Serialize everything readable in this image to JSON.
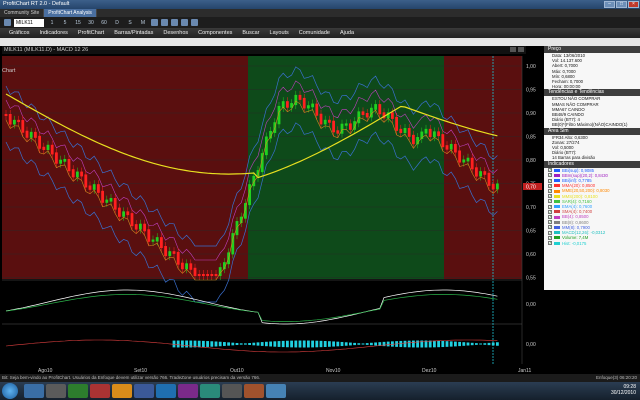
{
  "window": {
    "title": "ProfitChart RT 2.0 - Default"
  },
  "tabs": [
    {
      "label": "Community Site"
    },
    {
      "label": "ProfitChart Analysis"
    }
  ],
  "toolbar": {
    "symbol": "MILK11",
    "timeframes": [
      "1",
      "5",
      "15",
      "30",
      "60",
      "D",
      "S",
      "M"
    ]
  },
  "menu": [
    "Gráficos",
    "Indicadores",
    "ProfitChart",
    "Barras/Pintadas",
    "Desenhos",
    "Componentes",
    "Buscar",
    "Layouts",
    "Comunidade",
    "Ajuda"
  ],
  "chart": {
    "title": "MILK11 (MILK11.D) - MACD 12 26",
    "price_labels": [
      "1,00",
      "0,95",
      "0,90",
      "0,85",
      "0,80",
      "0,75",
      "0,70",
      "0,65",
      "0,60",
      "0,55"
    ],
    "last_price": "0,70",
    "macd_labels": [
      "0,00",
      "0,00"
    ],
    "x_labels": [
      "Ago10",
      "Set10",
      "Out10",
      "Nov10",
      "Dez10",
      "Jan11"
    ],
    "side_label": "Chart",
    "colors": {
      "bear": "#ff2020",
      "bull": "#20d020",
      "red_zone": "#5a0f0f",
      "green_zone": "#0e4a1a",
      "ma_yellow": "#e8e020"
    }
  },
  "right_panel": {
    "price_header": "Preço",
    "price_rows": [
      "Data: 13/06/2010",
      "Vol: 14.137.600",
      "Abert: 0,7000",
      "Máx: 0,7000",
      "Mín: 0,6800",
      "Fecham: 0,7000",
      "Hora: 00:00:00"
    ],
    "trend_header": "Tendências e Tendências",
    "trend_rows": [
      "ESTOU NÃO COMPRAR",
      "MMAS NÃO COMPRAR",
      "MMA67 CAINDO",
      "BB48/9 CAINDO",
      "Diário (BT7): 4",
      "BB(0)*(Filtro Máximo)(NÃO)CAINDO(1)"
    ],
    "area_header": "Área Sim",
    "area_rows": [
      "IFR34 Alto: 0,6300",
      "Zonas: 27/274",
      "Vol: 0,5000",
      "Diário (BT7):",
      "14 Barras para divisão"
    ],
    "ind_header": "Indicadores",
    "indicators": [
      {
        "label": "BBi(sup): 0,9085",
        "color": "#2060ff"
      },
      {
        "label": "BBm(sup)(20,2): 0,8430",
        "color": "#a020c0"
      },
      {
        "label": "BBi(inf): 0,7785",
        "color": "#2060ff"
      },
      {
        "label": "MMA(20): 0,8500",
        "color": "#ff3030"
      },
      {
        "label": "MME(20,50,200): 0,8030",
        "color": "#ff8800"
      },
      {
        "label": "MMS(200): 0,8100",
        "color": "#e8e020"
      },
      {
        "label": "SAR(4): 0,7160",
        "color": "#40c040"
      },
      {
        "label": "EMA(4): 0,7600",
        "color": "#30a0ff"
      },
      {
        "label": "SMA(4): 0,7400",
        "color": "#d04040"
      },
      {
        "label": "BB(4): 0,8500",
        "color": "#c040c0"
      },
      {
        "label": "BB(8): 0,8600",
        "color": "#808080"
      },
      {
        "label": "MM(8): 0,7900",
        "color": "#4060e0"
      },
      {
        "label": "MACD(12,26): -0,0312",
        "color": "#20c0c0"
      },
      {
        "label": "Volume: 7,4M",
        "color": "#20a020"
      },
      {
        "label": "Hist: -0,0175",
        "color": "#20d0d0"
      }
    ]
  },
  "status": {
    "text": "Bit: Seja bem-vindo ao ProfitChart. Usuários da Enfoque devem utilizar versão 766. TradeZone usuários precisam da versão 766.",
    "right": "Enfoque(3)  06:20:20"
  },
  "taskbar": {
    "time": "09:28",
    "date": "30/12/2010"
  }
}
